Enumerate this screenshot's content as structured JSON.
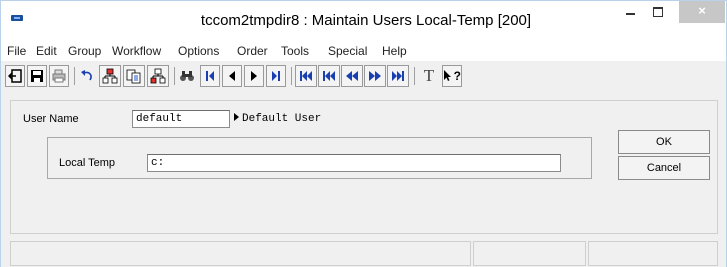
{
  "window": {
    "title": "tccom2tmpdir8 : Maintain Users Local-Temp [200]",
    "controls": {
      "minimize": "minimize",
      "maximize": "maximize",
      "close": "×"
    }
  },
  "menu": [
    "File",
    "Edit",
    "Group",
    "Workflow",
    "Options",
    "Order",
    "Tools",
    "Special",
    "Help"
  ],
  "toolbar": {
    "text_tool_label": "T",
    "help_tool_label": "?"
  },
  "form": {
    "user_name_label": "User Name",
    "user_name_value": "default",
    "user_description": "Default User",
    "local_temp_label": "Local Temp",
    "local_temp_value": "c:"
  },
  "buttons": {
    "ok": "OK",
    "cancel": "Cancel"
  },
  "status": [
    "",
    "",
    ""
  ]
}
